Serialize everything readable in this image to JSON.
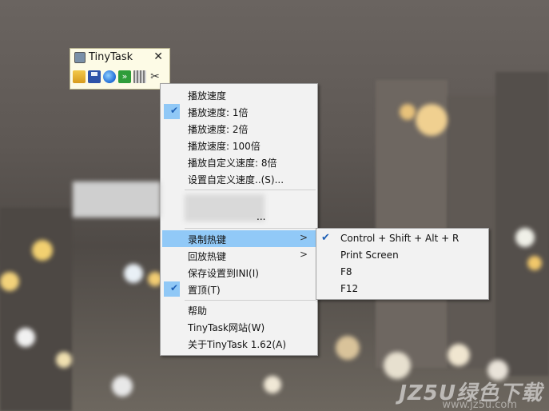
{
  "window": {
    "title": "TinyTask",
    "close_glyph": "✕",
    "toolbar": [
      "open-icon",
      "save-icon",
      "record-icon",
      "play-icon",
      "compile-icon",
      "prefs-icon"
    ]
  },
  "menu": {
    "speed_header": "播放速度",
    "speed_1x": "播放速度:  1倍",
    "speed_2x": "播放速度:  2倍",
    "speed_100x": "播放速度:  100倍",
    "custom_speed": "播放自定义速度:  8倍",
    "set_custom_speed": "设置自定义速度..(S)...",
    "obscured_item": "...",
    "record_hotkey": "录制热键",
    "playback_hotkey": "回放热键",
    "save_ini": "保存设置到INI(I)",
    "topmost": "置顶(T)",
    "help": "帮助",
    "website": "TinyTask网站(W)",
    "about": "关于TinyTask 1.62(A)",
    "submenu_arrow": ">"
  },
  "submenu": {
    "items": [
      "Control + Shift + Alt + R",
      "Print Screen",
      "F8",
      "F12"
    ],
    "checked_index": 0
  },
  "watermark": {
    "main": "JZ5U绿色下载",
    "sub": "www.jz5u.com"
  }
}
